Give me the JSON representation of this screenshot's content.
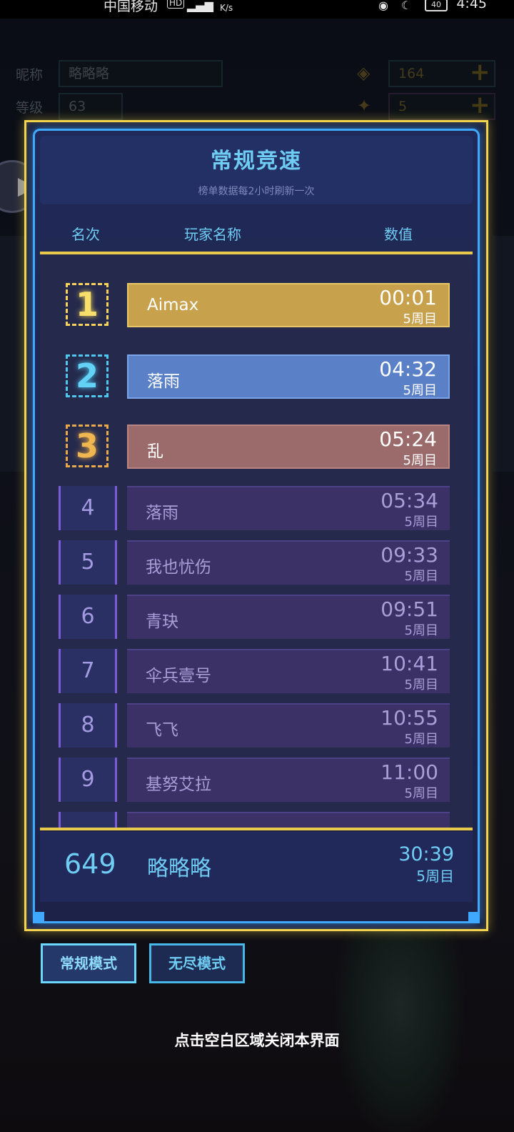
{
  "status_bar": {
    "carrier": "中国移动",
    "network_badge": "HD",
    "speed_unit": "K/s",
    "battery": "40",
    "time": "4:45"
  },
  "background_panel": {
    "nickname_label": "昵称",
    "nickname_value": "略略略",
    "level_label": "等级",
    "level_value": "63",
    "currency_value": "164",
    "energy_value": "5",
    "plus_symbol": "+"
  },
  "dialog": {
    "title": "常规竞速",
    "subtitle": "榜单数据每2小时刷新一次",
    "columns": {
      "rank": "名次",
      "player": "玩家名称",
      "value": "数值"
    },
    "rows": [
      {
        "rank": "1",
        "name": "Aimax",
        "time": "00:01",
        "lap": "5周目"
      },
      {
        "rank": "2",
        "name": "落雨",
        "time": "04:32",
        "lap": "5周目"
      },
      {
        "rank": "3",
        "name": "乱",
        "time": "05:24",
        "lap": "5周目"
      },
      {
        "rank": "4",
        "name": "落雨",
        "time": "05:34",
        "lap": "5周目"
      },
      {
        "rank": "5",
        "name": "我也忧伤",
        "time": "09:33",
        "lap": "5周目"
      },
      {
        "rank": "6",
        "name": "青玦",
        "time": "09:51",
        "lap": "5周目"
      },
      {
        "rank": "7",
        "name": "伞兵壹号",
        "time": "10:41",
        "lap": "5周目"
      },
      {
        "rank": "8",
        "name": "飞飞",
        "time": "10:55",
        "lap": "5周目"
      },
      {
        "rank": "9",
        "name": "基努艾拉",
        "time": "11:00",
        "lap": "5周目"
      }
    ],
    "me": {
      "rank": "649",
      "name": "略略略",
      "time": "30:39",
      "lap": "5周目"
    }
  },
  "modes": {
    "normal": "常规模式",
    "endless": "无尽模式"
  },
  "close_hint": "点击空白区域关闭本界面",
  "colors": {
    "gold_frame": "#f3d44c",
    "blue_frame": "#3fa9ff",
    "rank1": "#c7a14b",
    "rank2": "#5a80c8",
    "rank3": "#9b6a6b",
    "other": "#3c3167",
    "accent_text": "#6fcdf4"
  }
}
